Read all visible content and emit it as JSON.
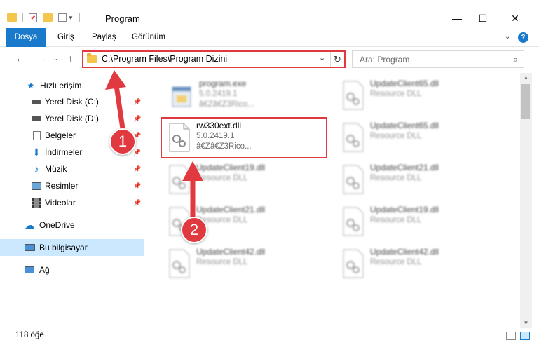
{
  "window": {
    "title": "Program",
    "minimize_glyph": "—",
    "maximize_glyph": "☐",
    "close_glyph": "✕"
  },
  "ribbon": {
    "tabs": [
      "Dosya",
      "Giriş",
      "Paylaş",
      "Görünüm"
    ],
    "help_glyph": "?"
  },
  "address": {
    "path": "C:\\Program Files\\Program Dizini",
    "search_placeholder": "Ara: Program"
  },
  "nav": {
    "quick_access": "Hızlı erişim",
    "items": [
      {
        "label": "Yerel Disk (C:)",
        "icon": "drive-icon"
      },
      {
        "label": "Yerel Disk (D:)",
        "icon": "drive-icon"
      },
      {
        "label": "Belgeler",
        "icon": "documents-icon"
      },
      {
        "label": "İndirmeler",
        "icon": "downloads-icon"
      },
      {
        "label": "Müzik",
        "icon": "music-icon"
      },
      {
        "label": "Resimler",
        "icon": "pictures-icon"
      },
      {
        "label": "Videolar",
        "icon": "videos-icon"
      }
    ],
    "onedrive": "OneDrive",
    "this_pc": "Bu bilgisayar",
    "network": "Ağ"
  },
  "files": {
    "left": [
      {
        "name": "program.exe",
        "type": "5.0.2419.1",
        "desc": "â€Zâ€Z3Rico..."
      },
      {
        "name": "rw330ext.dll",
        "type": "5.0.2419.1",
        "desc": "â€Zâ€Z3Rico..."
      },
      {
        "name": "UpdateClient19.dll",
        "type": "Resource DLL"
      },
      {
        "name": "UpdateClient21.dll",
        "type": "Resource DLL"
      },
      {
        "name": "UpdateClient42.dll",
        "type": "Resource DLL"
      }
    ],
    "right": [
      {
        "name": "UpdateClient65.dll",
        "type": "Resource DLL"
      },
      {
        "name": "UpdateClient65.dll",
        "type": "Resource DLL"
      },
      {
        "name": "UpdateClient21.dll",
        "type": "Resource DLL"
      },
      {
        "name": "UpdateClient19.dll",
        "type": "Resource DLL"
      },
      {
        "name": "UpdateClient42.dll",
        "type": "Resource DLL"
      }
    ]
  },
  "status": {
    "count": "118 öğe"
  },
  "annotations": {
    "step1": "1",
    "step2": "2",
    "color": "#e0393f"
  },
  "colors": {
    "accent": "#1979ca",
    "selection": "#cce8ff",
    "folder": "#f4c64e"
  }
}
